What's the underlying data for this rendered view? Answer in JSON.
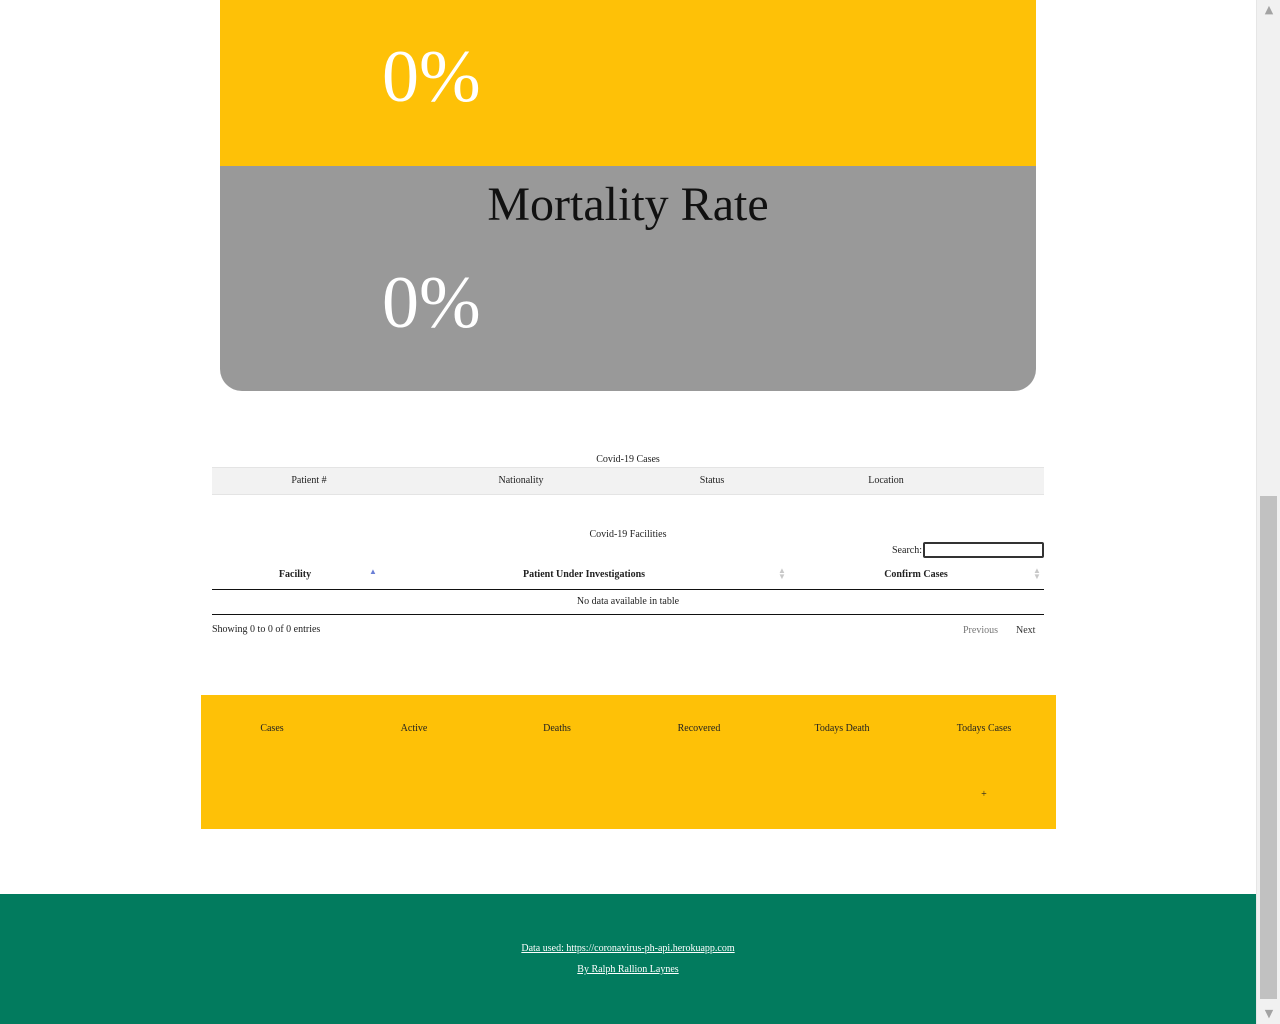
{
  "stats_card": {
    "top_value": "0%",
    "mortality_title": "Mortality Rate",
    "mortality_value": "0%"
  },
  "cases_table": {
    "caption": "Covid-19 Cases",
    "columns": [
      "Patient #",
      "Nationality",
      "Status",
      "Location"
    ]
  },
  "facilities_table": {
    "caption": "Covid-19 Facilities",
    "search_label": "Search:",
    "search_value": "",
    "columns": [
      "Facility",
      "Patient Under Investigations",
      "Confirm Cases"
    ],
    "empty_message": "No data available in table",
    "info": "Showing 0 to 0 of 0 entries",
    "previous_label": "Previous",
    "next_label": "Next"
  },
  "summary": {
    "labels": [
      "Cases",
      "Active",
      "Deaths",
      "Recovered",
      "Todays Death",
      "Todays Cases"
    ],
    "todays_cases_value": "+"
  },
  "footer": {
    "data_link": "Data used: https://coronavirus-ph-api.herokuapp.com",
    "author_link": "By Ralph Rallion Laynes"
  },
  "colors": {
    "yellow": "#fec107",
    "grey": "#999999",
    "green": "#027b5e"
  },
  "scrollbar": {
    "up_icon": "triangle-up-icon",
    "down_icon": "triangle-down-icon"
  }
}
